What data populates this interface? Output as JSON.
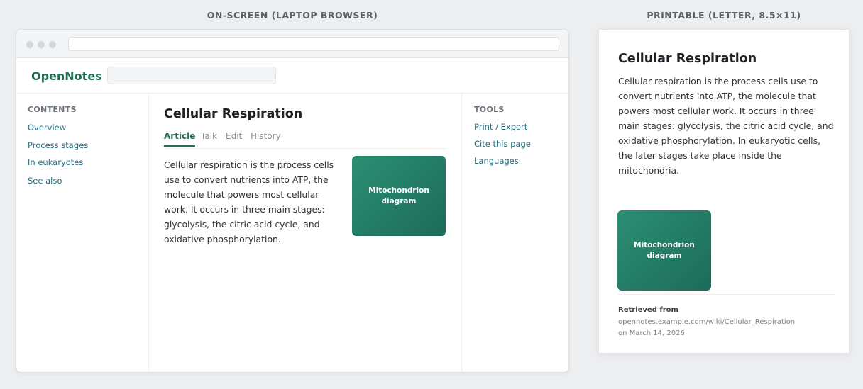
{
  "captions": {
    "screen": "ON-SCREEN (LAPTOP BROWSER)",
    "print": "PRINTABLE (LETTER, 8.5×11)"
  },
  "site": {
    "logo": "OpenNotes"
  },
  "contents": {
    "heading": "CONTENTS",
    "items": [
      "Overview",
      "Process stages",
      "In eukaryotes",
      "See also"
    ]
  },
  "article": {
    "title": "Cellular Respiration",
    "tabs": [
      "Article",
      "Talk",
      "Edit",
      "History"
    ],
    "active_tab": "Article",
    "body": "Cellular respiration is the process cells use to convert nutrients into ATP, the molecule that powers most cellular work. It occurs in three main stages: glycolysis, the citric acid cycle, and oxidative phosphorylation.",
    "figure_label": "Mitochondrion diagram"
  },
  "tools": {
    "heading": "TOOLS",
    "items": [
      "Print / Export",
      "Cite this page",
      "Languages"
    ]
  },
  "print": {
    "title": "Cellular Respiration",
    "body": "Cellular respiration is the process cells use to convert nutrients into ATP, the molecule that powers most cellular work. It occurs in three main stages: glycolysis, the citric acid cycle, and oxidative phosphorylation. In eukaryotic cells, the later stages take place inside the mitochondria.",
    "figure_label": "Mitochondrion diagram",
    "retrieved_label": "Retrieved from",
    "retrieved_url": "opennotes.example.com/wiki/Cellular_Respiration",
    "retrieved_date": "on March 14, 2026"
  },
  "colors": {
    "brand": "#1f6e58",
    "link": "#1f6e83",
    "figure_start": "#2b8f73",
    "figure_end": "#1d6b5a"
  }
}
